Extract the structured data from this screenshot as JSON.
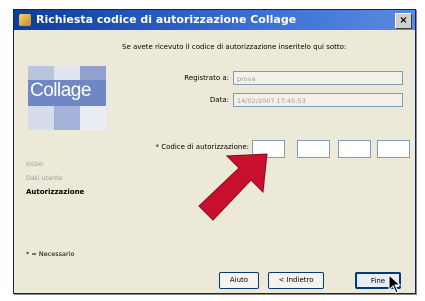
{
  "window": {
    "title": "Richiesta codice di autorizzazione Collage",
    "close_glyph": "×"
  },
  "instruction": "Se avete ricevuto il codice di autorizzazione inseritelo qui sotto:",
  "logo": {
    "text": "Collage"
  },
  "steps": [
    {
      "label": "Inizio",
      "active": false
    },
    {
      "label": "Dati utente",
      "active": false
    },
    {
      "label": "Autorizzazione",
      "active": true
    }
  ],
  "required_note": "* = Necessario",
  "form": {
    "registrato_label": "Registrato a:",
    "registrato_value": "prova",
    "date_label": "Data:",
    "date_value": "14/02/2007 17:45:53",
    "code_label": "* Codice di autorizzazione:"
  },
  "buttons": {
    "help": "Aiuto",
    "back": "< Indietro",
    "finish": "Fine"
  },
  "colors": {
    "arrow": "#c8102e",
    "title_bar": "#0a3d9c"
  },
  "icons": {
    "arrow": "red-arrow-icon",
    "cursor": "mouse-pointer-icon"
  }
}
